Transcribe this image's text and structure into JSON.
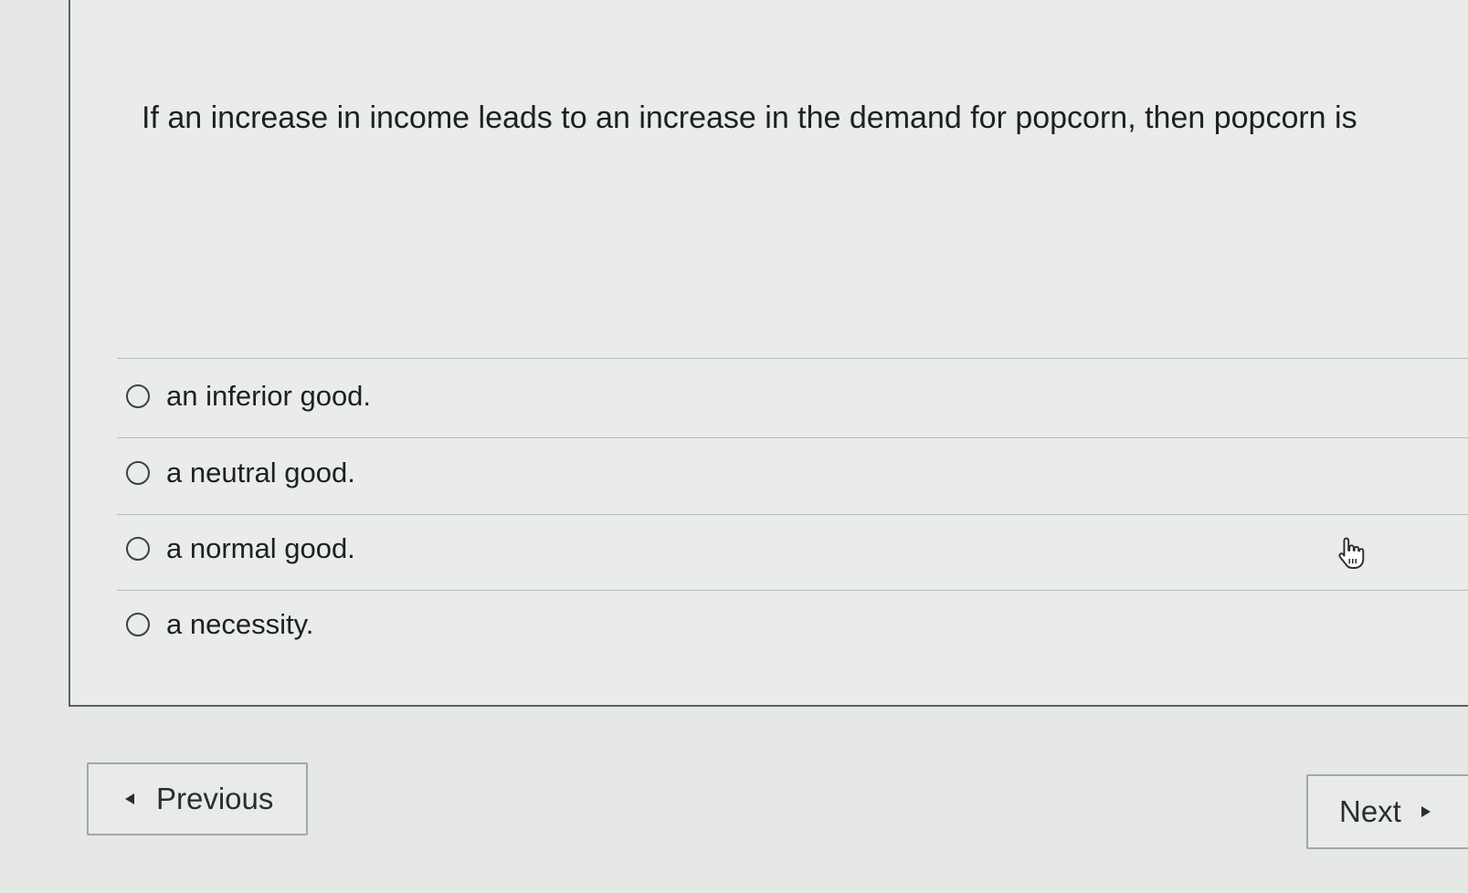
{
  "question": {
    "text": "If an increase in income leads to an increase in the demand for popcorn, then popcorn is"
  },
  "options": [
    {
      "label": "an inferior good.",
      "selected": false
    },
    {
      "label": "a neutral good.",
      "selected": false
    },
    {
      "label": "a normal good.",
      "selected": false
    },
    {
      "label": "a necessity.",
      "selected": false
    }
  ],
  "navigation": {
    "previous_label": "Previous",
    "next_label": "Next",
    "previous_icon": "caret-left-icon",
    "next_icon": "caret-right-icon"
  },
  "cursor": {
    "icon": "hand-pointer-icon"
  },
  "colors": {
    "background": "#e6e8e6",
    "text": "#1d2024",
    "border": "#5c6066"
  }
}
